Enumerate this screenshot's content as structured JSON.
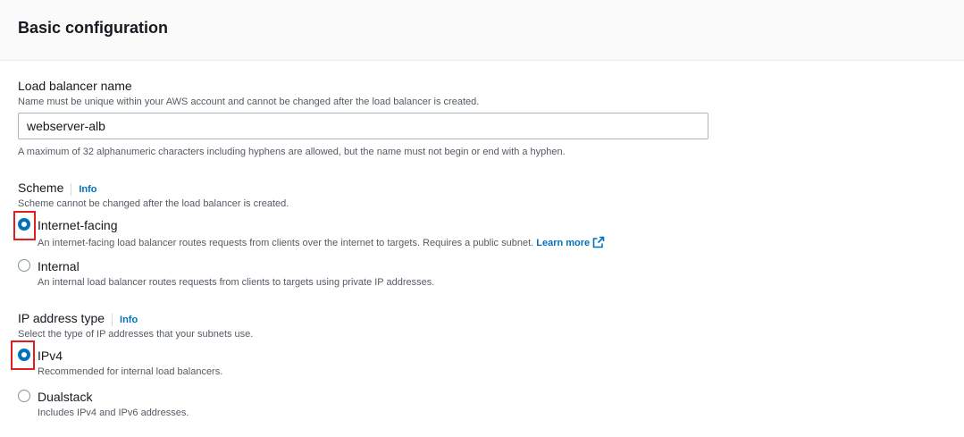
{
  "section": {
    "title": "Basic configuration"
  },
  "name_field": {
    "label": "Load balancer name",
    "description": "Name must be unique within your AWS account and cannot be changed after the load balancer is created.",
    "value": "webserver-alb",
    "constraint": "A maximum of 32 alphanumeric characters including hyphens are allowed, but the name must not begin or end with a hyphen."
  },
  "scheme": {
    "label": "Scheme",
    "info": "Info",
    "description": "Scheme cannot be changed after the load balancer is created.",
    "options": [
      {
        "label": "Internet-facing",
        "description": "An internet-facing load balancer routes requests from clients over the internet to targets. Requires a public subnet.",
        "link": "Learn more",
        "selected": true
      },
      {
        "label": "Internal",
        "description": "An internal load balancer routes requests from clients to targets using private IP addresses.",
        "selected": false
      }
    ]
  },
  "ip_type": {
    "label": "IP address type",
    "info": "Info",
    "description": "Select the type of IP addresses that your subnets use.",
    "options": [
      {
        "label": "IPv4",
        "description": "Recommended for internal load balancers.",
        "selected": true
      },
      {
        "label": "Dualstack",
        "description": "Includes IPv4 and IPv6 addresses.",
        "selected": false
      }
    ]
  },
  "colors": {
    "accent": "#0073bb",
    "highlight": "#e01e1e"
  },
  "icons": {
    "external_link": "external-link-icon"
  }
}
